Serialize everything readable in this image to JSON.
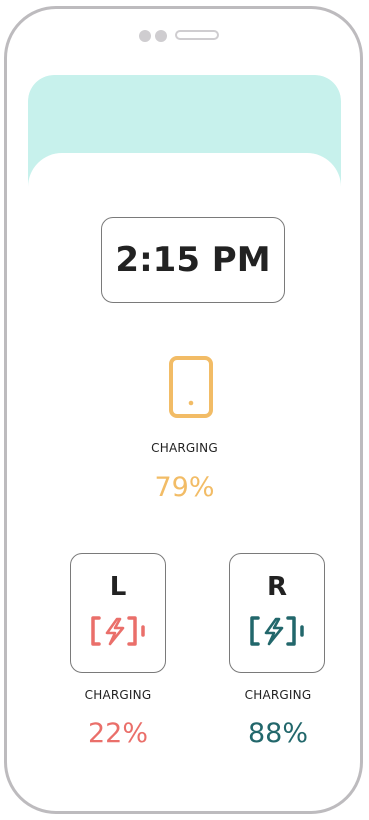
{
  "status": {
    "time": "2:15 PM"
  },
  "phone": {
    "icon": "smartphone-icon",
    "status_label": "CHARGING",
    "percent": "79%",
    "color": "#f2bc66"
  },
  "earbuds": {
    "left": {
      "letter": "L",
      "icon": "battery-charging-icon",
      "status_label": "CHARGING",
      "percent": "22%",
      "color": "#ea6f6a"
    },
    "right": {
      "letter": "R",
      "icon": "battery-charging-icon",
      "status_label": "CHARGING",
      "percent": "88%",
      "color": "#22676b"
    }
  },
  "theme": {
    "header_color": "#c7f1ec",
    "frame_color": "#bdbbbe"
  }
}
